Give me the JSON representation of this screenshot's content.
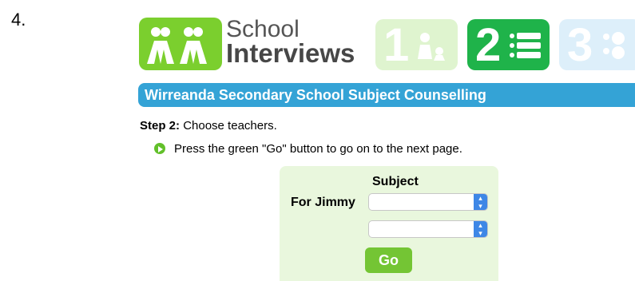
{
  "step_number_label": "4.",
  "logo": {
    "line1": "School",
    "line2": "Interviews"
  },
  "steps": [
    {
      "number": "1",
      "icon": "person-icon"
    },
    {
      "number": "2",
      "icon": "list-icon"
    },
    {
      "number": "3",
      "icon": "schedule-icon"
    }
  ],
  "banner": {
    "title": "Wirreanda Secondary School Subject Counselling"
  },
  "step": {
    "label": "Step 2:",
    "text": "Choose teachers."
  },
  "instruction": "Press the green \"Go\" button to go on to the next page.",
  "form": {
    "column_header": "Subject",
    "row_label": "For Jimmy",
    "select1_value": "",
    "select2_value": "",
    "go_label": "Go"
  },
  "colors": {
    "green": "#74c534",
    "dark_green": "#1fb34a",
    "blue": "#34a3d6",
    "panel_bg": "#e9f7dd"
  }
}
